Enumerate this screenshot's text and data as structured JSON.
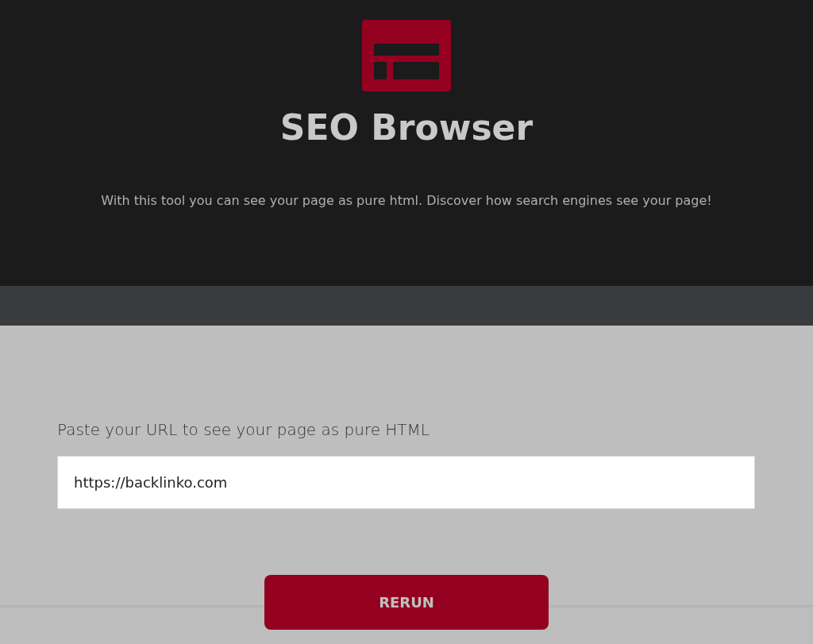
{
  "header": {
    "title": "SEO Browser",
    "description": "With this tool you can see your page as pure html. Discover how search engines see your page!"
  },
  "form": {
    "label": "Paste your URL to see your page as pure HTML",
    "url": "https://backlinko.com",
    "button": "RERUN"
  }
}
